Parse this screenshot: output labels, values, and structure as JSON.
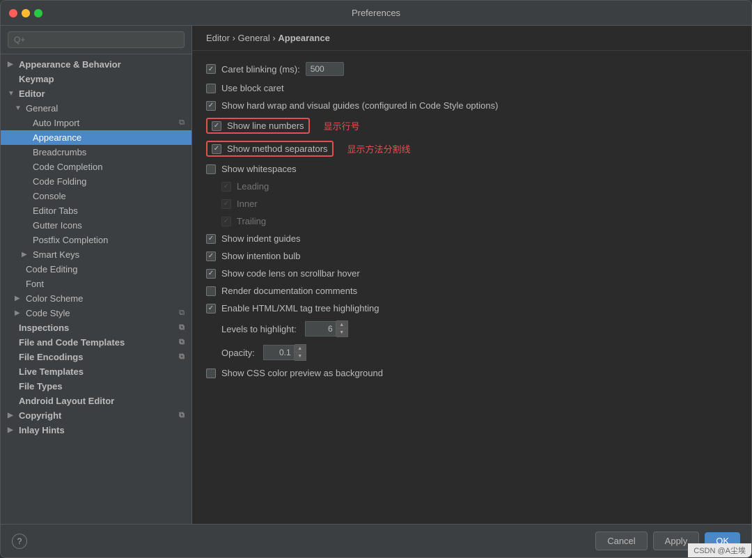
{
  "window": {
    "title": "Preferences"
  },
  "search": {
    "placeholder": "Q+"
  },
  "breadcrumb": {
    "parts": [
      "Editor",
      "General",
      "Appearance"
    ]
  },
  "sidebar": {
    "items": [
      {
        "id": "appearance-behavior",
        "label": "Appearance & Behavior",
        "level": 0,
        "arrow": "▶",
        "selected": false
      },
      {
        "id": "keymap",
        "label": "Keymap",
        "level": 0,
        "arrow": "",
        "selected": false
      },
      {
        "id": "editor",
        "label": "Editor",
        "level": 0,
        "arrow": "▼",
        "selected": false
      },
      {
        "id": "general",
        "label": "General",
        "level": 1,
        "arrow": "▼",
        "selected": false
      },
      {
        "id": "auto-import",
        "label": "Auto Import",
        "level": 2,
        "arrow": "",
        "selected": false,
        "badge": "⧉"
      },
      {
        "id": "appearance",
        "label": "Appearance",
        "level": 2,
        "arrow": "",
        "selected": true
      },
      {
        "id": "breadcrumbs",
        "label": "Breadcrumbs",
        "level": 2,
        "arrow": "",
        "selected": false
      },
      {
        "id": "code-completion",
        "label": "Code Completion",
        "level": 2,
        "arrow": "",
        "selected": false
      },
      {
        "id": "code-folding",
        "label": "Code Folding",
        "level": 2,
        "arrow": "",
        "selected": false
      },
      {
        "id": "console",
        "label": "Console",
        "level": 2,
        "arrow": "",
        "selected": false
      },
      {
        "id": "editor-tabs",
        "label": "Editor Tabs",
        "level": 2,
        "arrow": "",
        "selected": false
      },
      {
        "id": "gutter-icons",
        "label": "Gutter Icons",
        "level": 2,
        "arrow": "",
        "selected": false
      },
      {
        "id": "postfix-completion",
        "label": "Postfix Completion",
        "level": 2,
        "arrow": "",
        "selected": false
      },
      {
        "id": "smart-keys",
        "label": "Smart Keys",
        "level": 2,
        "arrow": "▶",
        "selected": false
      },
      {
        "id": "code-editing",
        "label": "Code Editing",
        "level": 1,
        "arrow": "",
        "selected": false
      },
      {
        "id": "font",
        "label": "Font",
        "level": 1,
        "arrow": "",
        "selected": false
      },
      {
        "id": "color-scheme",
        "label": "Color Scheme",
        "level": 1,
        "arrow": "▶",
        "selected": false
      },
      {
        "id": "code-style",
        "label": "Code Style",
        "level": 1,
        "arrow": "▶",
        "selected": false,
        "badge": "⧉"
      },
      {
        "id": "inspections",
        "label": "Inspections",
        "level": 0,
        "arrow": "",
        "selected": false,
        "badge": "⧉"
      },
      {
        "id": "file-code-templates",
        "label": "File and Code Templates",
        "level": 0,
        "arrow": "",
        "selected": false,
        "badge": "⧉"
      },
      {
        "id": "file-encodings",
        "label": "File Encodings",
        "level": 0,
        "arrow": "",
        "selected": false,
        "badge": "⧉"
      },
      {
        "id": "live-templates",
        "label": "Live Templates",
        "level": 0,
        "arrow": "",
        "selected": false
      },
      {
        "id": "file-types",
        "label": "File Types",
        "level": 0,
        "arrow": "",
        "selected": false
      },
      {
        "id": "android-layout-editor",
        "label": "Android Layout Editor",
        "level": 0,
        "arrow": "",
        "selected": false
      },
      {
        "id": "copyright",
        "label": "Copyright",
        "level": 0,
        "arrow": "▶",
        "selected": false,
        "badge": "⧉"
      },
      {
        "id": "inlay-hints",
        "label": "Inlay Hints",
        "level": 0,
        "arrow": "▶",
        "selected": false
      }
    ]
  },
  "settings": {
    "caret_blinking_label": "Caret blinking (ms):",
    "caret_blinking_value": "500",
    "use_block_caret": "Use block caret",
    "show_hard_wrap": "Show hard wrap and visual guides (configured in Code Style options)",
    "show_line_numbers": "Show line numbers",
    "show_method_separators": "Show method separators",
    "show_whitespaces": "Show whitespaces",
    "leading": "Leading",
    "inner": "Inner",
    "trailing": "Trailing",
    "show_indent_guides": "Show indent guides",
    "show_intention_bulb": "Show intention bulb",
    "show_code_lens": "Show code lens on scrollbar hover",
    "render_doc_comments": "Render documentation comments",
    "enable_html_xml": "Enable HTML/XML tag tree highlighting",
    "levels_label": "Levels to highlight:",
    "levels_value": "6",
    "opacity_label": "Opacity:",
    "opacity_value": "0.1",
    "show_css_color": "Show CSS color preview as background",
    "annotation_line_numbers": "显示行号",
    "annotation_separators": "显示方法分割线"
  },
  "footer": {
    "cancel": "Cancel",
    "apply": "Apply",
    "ok": "OK",
    "watermark": "CSDN @A尘埃"
  }
}
